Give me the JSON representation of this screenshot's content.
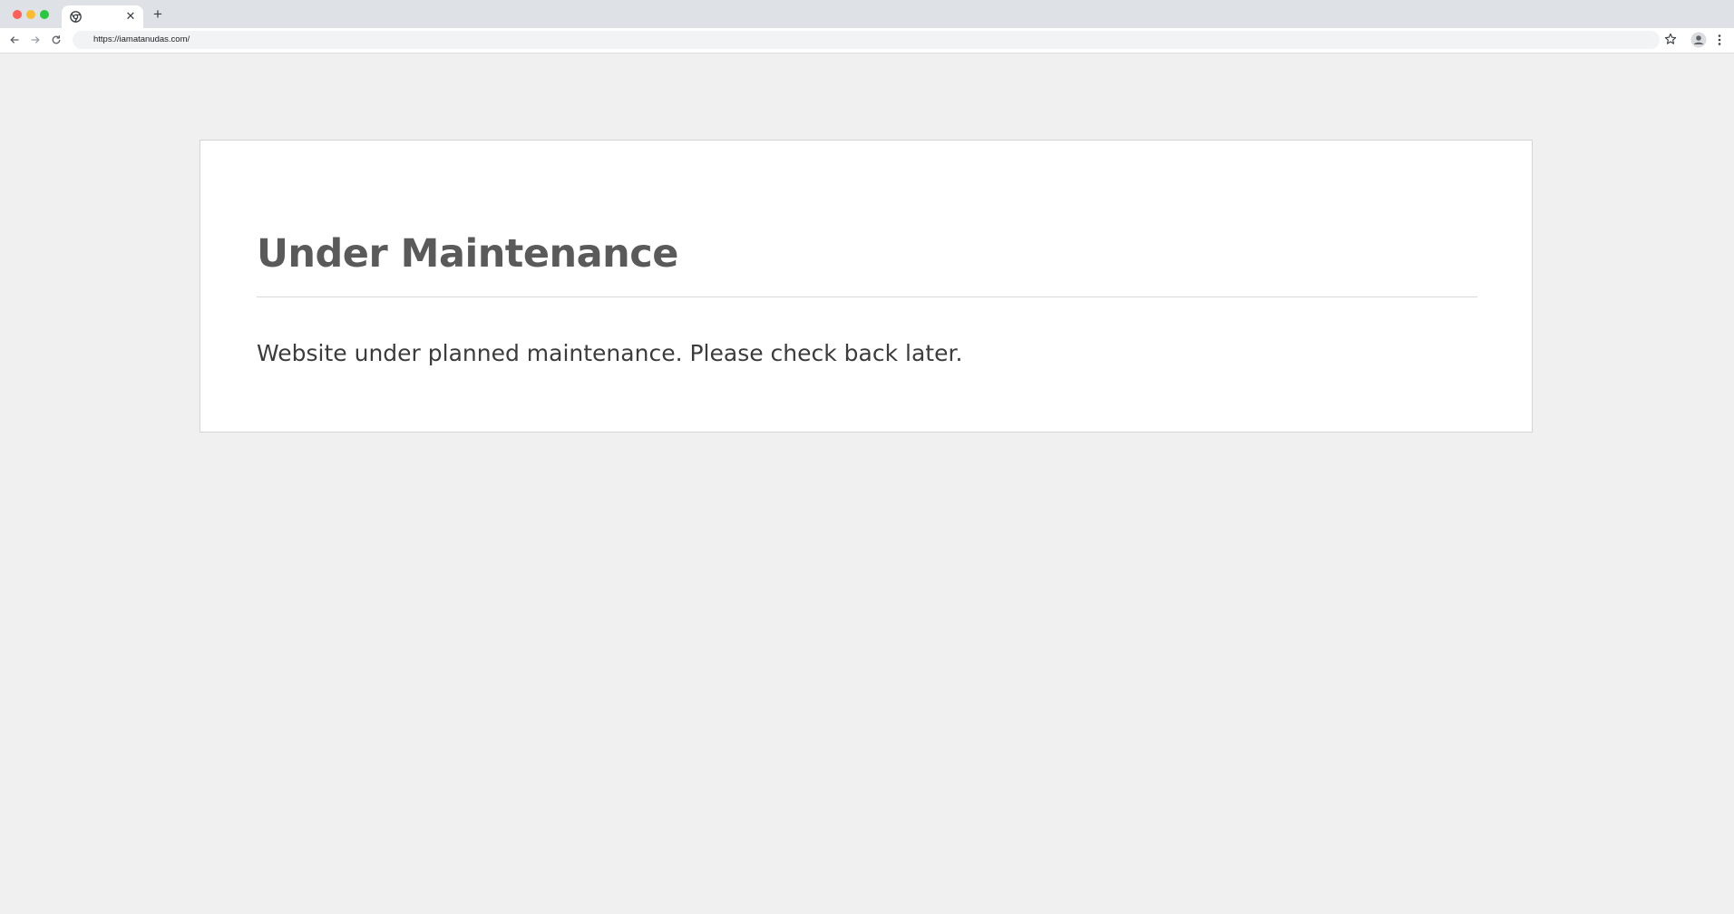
{
  "browser": {
    "tab": {
      "favicon": "chrome-globe-icon",
      "close_glyph": "✕"
    },
    "new_tab_glyph": "+",
    "toolbar": {
      "back_icon": "back-arrow-icon",
      "forward_icon": "forward-arrow-icon",
      "reload_icon": "reload-icon",
      "url": "https://iamatanudas.com/",
      "bookmark_icon": "star-icon",
      "profile_icon": "profile-avatar-icon",
      "menu_icon": "more-vert-icon"
    }
  },
  "page": {
    "title": "Under Maintenance",
    "message": "Website under planned maintenance. Please check back later."
  },
  "colors": {
    "page_background": "#f0f0f0",
    "card_background": "#ffffff",
    "title_text": "#5a5a5a",
    "body_text": "#3c3c3c"
  }
}
